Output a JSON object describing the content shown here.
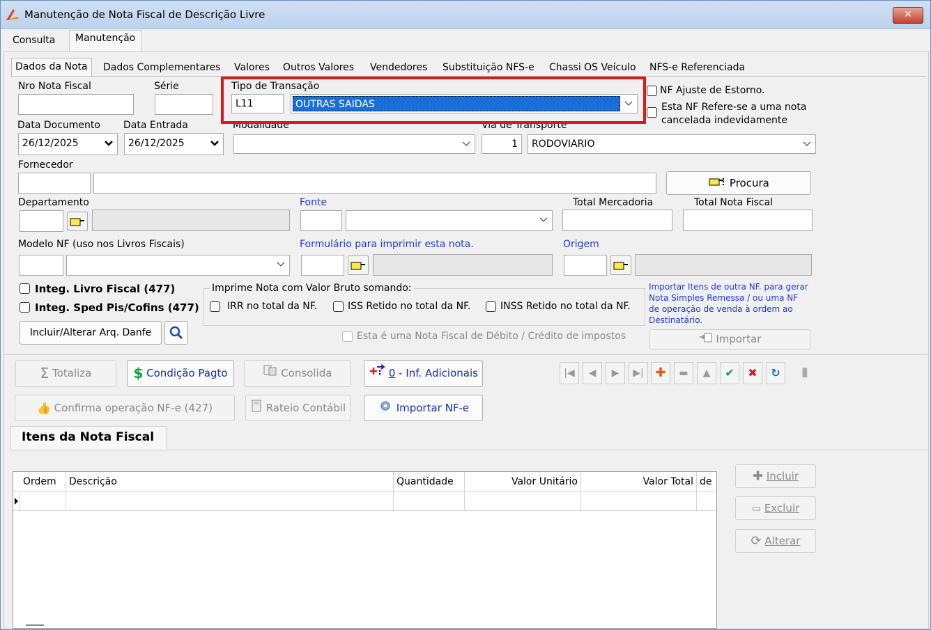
{
  "window": {
    "title": "Manutenção de Nota Fiscal de Descrição Livre",
    "close_glyph": "✕"
  },
  "top_tabs": [
    "Consulta",
    "Manutenção"
  ],
  "inner_tabs": [
    "Dados da Nota",
    "Dados Complementares",
    "Valores",
    "Outros Valores",
    "Vendedores",
    "Substituição NFS-e",
    "Chassi OS Veículo",
    "NFS-e Referenciada"
  ],
  "form": {
    "nro_nota_fiscal": {
      "label": "Nro Nota Fiscal",
      "value": ""
    },
    "serie": {
      "label": "Série",
      "value": ""
    },
    "tipo_transacao": {
      "label": "Tipo de Transação",
      "code": "L11",
      "selected": "OUTRAS SAIDAS"
    },
    "nf_ajuste_estorno": {
      "label": "NF Ajuste de Estorno.",
      "checked": false
    },
    "nf_cancelada": {
      "label_line1": "Esta NF Refere-se a uma nota",
      "label_line2": "cancelada indevidamente",
      "checked": false
    },
    "data_documento": {
      "label": "Data Documento",
      "value": "26/12/2025"
    },
    "data_entrada": {
      "label": "Data Entrada",
      "value": "26/12/2025"
    },
    "modalidade": {
      "label": "Modalidade",
      "value": ""
    },
    "via_transporte": {
      "label": "Via de Transporte",
      "code": "1",
      "selected": "RODOVIARIO"
    },
    "fornecedor": {
      "label": "Fornecedor",
      "code": "",
      "name": ""
    },
    "procura_button": "Procura",
    "departamento": {
      "label": "Departamento",
      "code": "",
      "name": ""
    },
    "fonte": {
      "label": "Fonte",
      "code": "",
      "selected": ""
    },
    "total_mercadoria": {
      "label": "Total Mercadoria",
      "value": ""
    },
    "total_nota_fiscal": {
      "label": "Total Nota Fiscal",
      "value": ""
    },
    "modelo_nf": {
      "label": "Modelo NF (uso nos Livros Fiscais)",
      "code": "",
      "selected": ""
    },
    "formulario": {
      "label": "Formulário para imprimir esta nota.",
      "code": "",
      "name": ""
    },
    "origem": {
      "label": "Origem",
      "code": "",
      "name": ""
    },
    "integ_livro_fiscal": {
      "label": "Integ. Livro Fiscal (477)",
      "checked": false
    },
    "integ_sped": {
      "label": "Integ. Sped Pis/Cofins (477)",
      "checked": false
    },
    "incluir_danfe_button": "Incluir/Alterar Arq. Danfe",
    "imprime_group": {
      "title": "Imprime Nota com Valor Bruto somando:",
      "irr": "IRR no total da NF.",
      "iss": "ISS Retido no total da NF.",
      "inss": "INSS Retido no total da NF."
    },
    "importar_info": "Importar Itens de outra NF. para gerar Nota Simples Remessa / ou uma NF de operação de venda à ordem ao Destinatário.",
    "importar_info_lines": [
      "Importar Itens de outra NF. para gerar",
      "Nota Simples Remessa / ou uma NF",
      "de operação de venda à ordem ao",
      "Destinatário."
    ],
    "importar_button": "Importar",
    "debito_credito": {
      "label": "Esta é uma Nota Fiscal de Débito / Crédito de impostos",
      "checked": false
    }
  },
  "actions": {
    "totaliza": "Totaliza",
    "condicao_pagto": "Condição Pagto",
    "consolida": "Consolida",
    "inf_adicionais_num": "0",
    "inf_adicionais": " - Inf. Adicionais",
    "confirma_nfe": "Confirma operação NF-e (427)",
    "rateio_contabil": "Rateio Contábil",
    "importar_nfe": "Importar NF-e"
  },
  "navigator": [
    "first-icon",
    "prior-icon",
    "next-icon",
    "last-icon",
    "insert-icon",
    "delete-icon",
    "edit-icon",
    "post-icon",
    "cancel-icon",
    "refresh-icon"
  ],
  "itens": {
    "title": "Itens da Nota Fiscal",
    "columns": [
      "Ordem",
      "Descrição",
      "Quantidade",
      "Valor Unitário",
      "Valor Total",
      "de"
    ],
    "rows": []
  },
  "item_buttons": {
    "incluir": "Incluir",
    "excluir": "Excluir",
    "alterar": "Alterar"
  },
  "colors": {
    "highlight": "#d71a1a",
    "selection": "#1a6fd6",
    "link_blue": "#1a3ad6"
  }
}
